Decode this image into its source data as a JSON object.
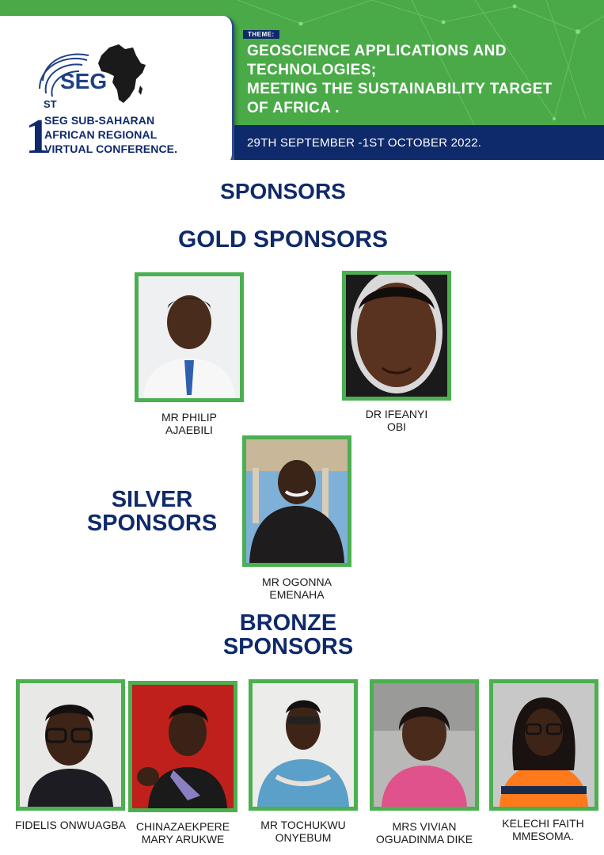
{
  "header": {
    "logo_text": "SEG",
    "conference": {
      "ordinal_number": "1",
      "ordinal_suffix": "ST",
      "line1": "SEG SUB-SAHARAN",
      "line2": "AFRICAN REGIONAL",
      "line3": "VIRTUAL CONFERENCE."
    },
    "theme_label": "THEME:",
    "theme_lines": [
      "GEOSCIENCE APPLICATIONS AND",
      "TECHNOLOGIES;",
      "MEETING THE SUSTAINABILITY TARGET",
      "OF AFRICA ."
    ],
    "dates": "29TH SEPTEMBER -1ST OCTOBER 2022."
  },
  "headings": {
    "sponsors": "SPONSORS",
    "gold": "GOLD SPONSORS",
    "silver_line1": "SILVER",
    "silver_line2": "SPONSORS",
    "bronze_line1": "BRONZE",
    "bronze_line2": "SPONSORS"
  },
  "gold_sponsors": [
    {
      "name_line1": "MR PHILIP",
      "name_line2": "AJAEBILI"
    },
    {
      "name_line1": "DR IFEANYI",
      "name_line2": "OBI"
    }
  ],
  "silver_sponsors": [
    {
      "name_line1": "MR OGONNA",
      "name_line2": "EMENAHA"
    }
  ],
  "bronze_sponsors": [
    {
      "name_line1": "FIDELIS ONWUAGBA",
      "name_line2": ""
    },
    {
      "name_line1": "CHINAZAEKPERE",
      "name_line2": "MARY ARUKWE"
    },
    {
      "name_line1": "MR TOCHUKWU",
      "name_line2": "ONYEBUM"
    },
    {
      "name_line1": "MRS VIVIAN",
      "name_line2": "OGUADINMA DIKE"
    },
    {
      "name_line1": "KELECHI FAITH",
      "name_line2": "MMESOMA."
    }
  ],
  "colors": {
    "brand_green": "#4aaa48",
    "brand_navy": "#0f2a6b",
    "frame_green": "#4caf50"
  }
}
